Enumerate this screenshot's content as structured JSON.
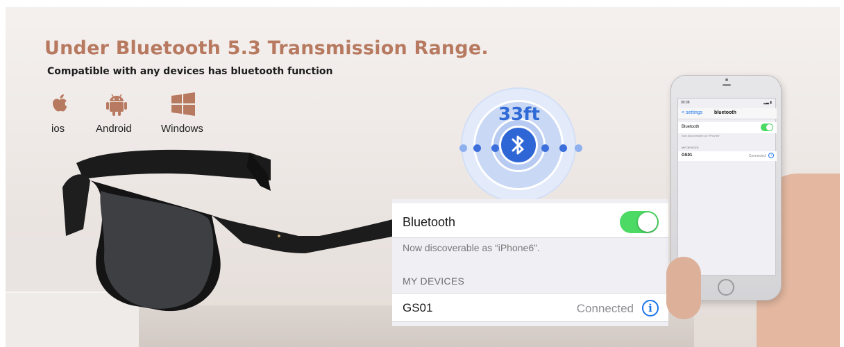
{
  "headline": "Under Bluetooth 5.3 Transmission Range.",
  "subline": "Compatible with any devices has bluetooth function",
  "os": [
    {
      "label": "ios",
      "icon": "apple-icon"
    },
    {
      "label": "Android",
      "icon": "android-icon"
    },
    {
      "label": "Windows",
      "icon": "windows-icon"
    }
  ],
  "range": "33ft",
  "colors": {
    "headline": "#b77a60",
    "accent_blue": "#2f6ad6",
    "toggle_green": "#4cd964"
  },
  "settings_panel": {
    "bluetooth_label": "Bluetooth",
    "discoverable_text": "Now discoverable as “iPhone6”.",
    "my_devices_header": "MY DEVICES",
    "device_name": "GS01",
    "device_status": "Connected",
    "info_glyph": "i",
    "toggle_on": true
  },
  "phone_screen": {
    "status_time": "09:38",
    "status_right": "▂▃ ▮",
    "back_label": "< settings",
    "title": "bluetooth",
    "bluetooth_label": "Bluetooth",
    "discoverable_text": "Now discoverable as “iPhone6”.",
    "my_devices_header": "MY DEVICES",
    "device_name": "GS01",
    "device_status": "Connected",
    "info_glyph": "i"
  }
}
